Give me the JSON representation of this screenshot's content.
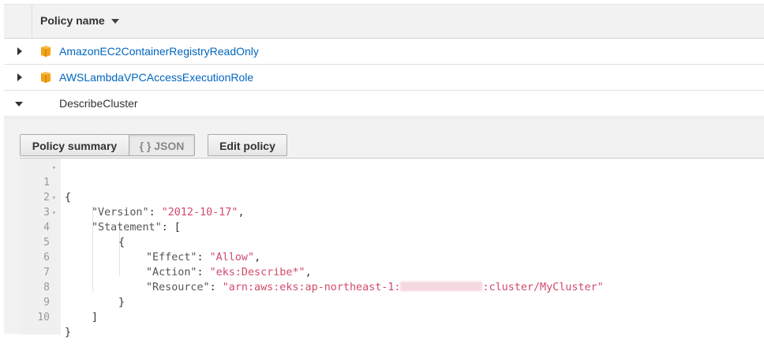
{
  "table": {
    "header": {
      "column": "Policy name"
    },
    "rows": [
      {
        "name": "AmazonEC2ContainerRegistryReadOnly",
        "icon": "aws-managed-policy-icon",
        "expanded": false
      },
      {
        "name": "AWSLambdaVPCAccessExecutionRole",
        "icon": "aws-managed-policy-icon",
        "expanded": false
      },
      {
        "name": "DescribeCluster",
        "expanded": true
      }
    ]
  },
  "detail": {
    "tabs": {
      "summary": "Policy summary",
      "json": "{ } JSON",
      "active": "json"
    },
    "edit_button": "Edit policy",
    "editor": {
      "line_numbers": [
        "1",
        "2",
        "3",
        "4",
        "5",
        "6",
        "7",
        "8",
        "9",
        "10"
      ],
      "version_key": "\"Version\"",
      "version_value": "\"2012-10-17\"",
      "statement_key": "\"Statement\"",
      "effect_key": "\"Effect\"",
      "effect_value": "\"Allow\"",
      "action_key": "\"Action\"",
      "action_value": "\"eks:Describe*\"",
      "resource_key": "\"Resource\"",
      "resource_prefix": "\"arn:aws:eks:ap-northeast-1:",
      "resource_suffix": ":cluster/MyCluster\""
    }
  },
  "colors": {
    "link": "#0066c0",
    "string": "#d14a6b",
    "icon": "#f3a31a"
  }
}
